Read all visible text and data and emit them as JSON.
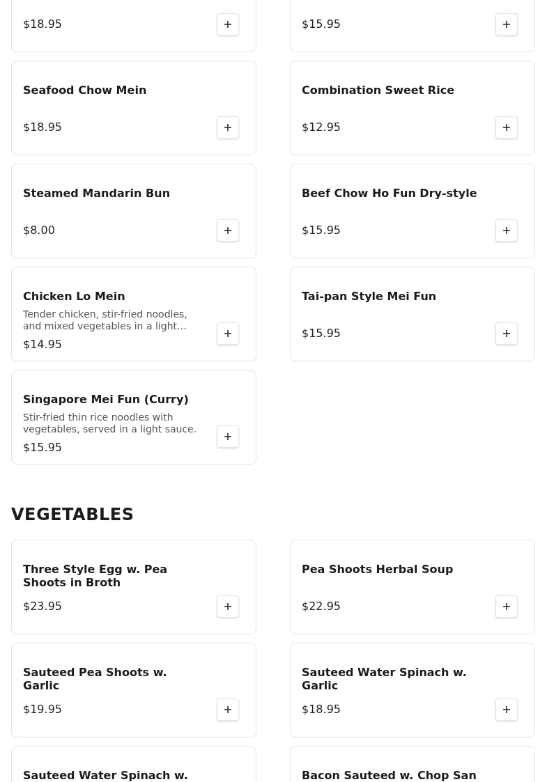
{
  "sections": [
    {
      "items": [
        {
          "price": "$18.95"
        },
        {
          "price": "$15.95"
        },
        {
          "name": "Seafood Chow Mein",
          "price": "$18.95"
        },
        {
          "name": "Combination Sweet Rice",
          "price": "$12.95"
        },
        {
          "name": "Steamed Mandarin Bun",
          "price": "$8.00"
        },
        {
          "name": "Beef Chow Ho Fun Dry-style",
          "price": "$15.95"
        },
        {
          "name": "Chicken Lo Mein",
          "description": "Tender chicken, stir-fried noodles, and mixed vegetables in a light…",
          "price": "$14.95"
        },
        {
          "name": "Tai-pan Style Mei Fun",
          "price": "$15.95"
        },
        {
          "name": "Singapore Mei Fun (Curry)",
          "description": "Stir-fried thin rice noodles with vegetables, served in a light sauce.",
          "price": "$15.95"
        }
      ]
    },
    {
      "heading": "VEGETABLES",
      "items": [
        {
          "name": "Three Style Egg w. Pea Shoots in Broth",
          "price": "$23.95"
        },
        {
          "name": "Pea Shoots Herbal Soup",
          "price": "$22.95"
        },
        {
          "name": "Sauteed Pea Shoots w. Garlic",
          "price": "$19.95"
        },
        {
          "name": "Sauteed Water Spinach w. Garlic",
          "price": "$18.95"
        },
        {
          "name": "Sauteed Water Spinach w."
        },
        {
          "name": "Bacon Sauteed w. Chop San"
        }
      ]
    }
  ]
}
